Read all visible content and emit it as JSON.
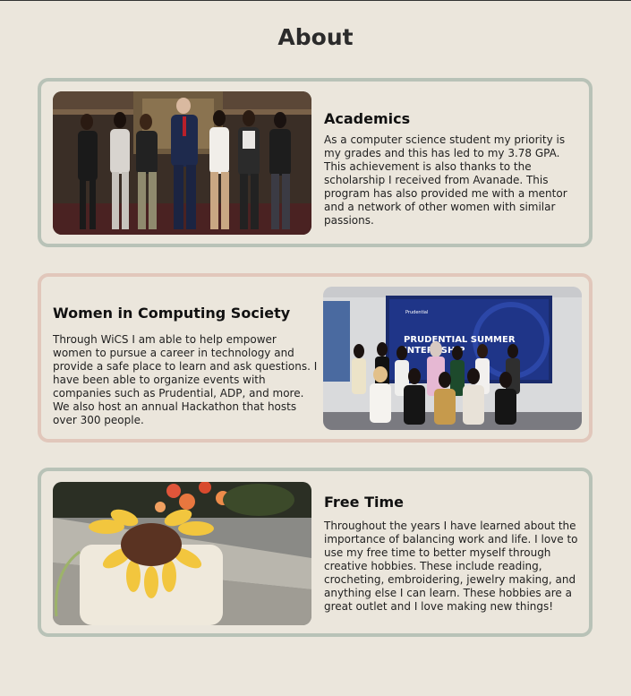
{
  "page": {
    "title": "About"
  },
  "sections": [
    {
      "title": "Academics",
      "body": "As a computer science student my priority is my grades and this has led to my 3.78 GPA. This achievement is also thanks to the scholarship I received from Avanade. This program has also provided me with a mentor and a network of other women with similar passions.",
      "image": "group-photo-formal",
      "border_color": "#b8c2b7"
    },
    {
      "title": "Women in Computing Society",
      "body": "Through WiCS I am able to help empower women to pursue a career in technology and provide a safe place to learn and ask questions. I have been able to organize events with companies such as Prudential, ADP, and more. We also host an annual Hackathon that hosts over 300 people.",
      "image": "group-photo-prudential-event",
      "screen_text": "PRUDENTIAL SUMMER INTERNSHIP",
      "screen_logo": "Prudential",
      "border_color": "#e1c7bb"
    },
    {
      "title": "Free Time",
      "body": "Throughout the years I have learned about the importance of balancing work and life. I love to use my free time to better myself through creative hobbies. These include reading, crocheting, embroidering, jewelry making, and anything else I can learn. These hobbies are a great outlet and I love making new things!",
      "image": "crocheted-sunflower-bag-photo",
      "border_color": "#b8c2b7"
    }
  ]
}
